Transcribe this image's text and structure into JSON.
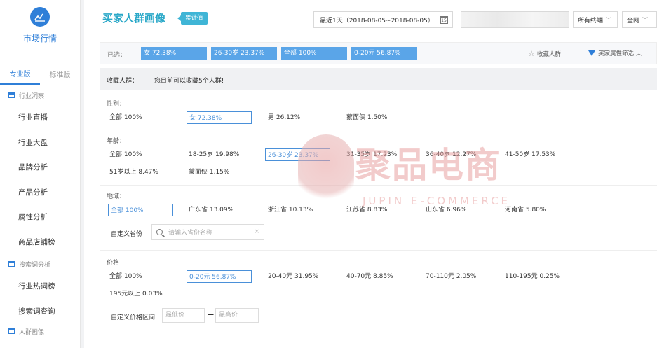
{
  "sidebar": {
    "title": "市场行情",
    "editions": [
      "专业版",
      "标准版"
    ],
    "groups": [
      {
        "label": "行业洞察",
        "items": [
          "行业直播",
          "行业大盘",
          "品牌分析",
          "产品分析",
          "属性分析",
          "商品店铺榜"
        ]
      },
      {
        "label": "搜索词分析",
        "items": [
          "行业热词榜",
          "搜索词查询"
        ]
      },
      {
        "label": "人群画像"
      }
    ]
  },
  "header": {
    "title": "买家人群画像",
    "badge": "累计值",
    "date_range": "最近1天（2018-08-05~2018-08-05）",
    "cal_day": "15",
    "terminal_select": "所有终端",
    "network_select": "全网"
  },
  "selection": {
    "label": "已选：",
    "tags": [
      "女 72.38%",
      "26-30岁 23.37%",
      "全部 100%",
      "0-20元 56.87%"
    ],
    "fav_label": "收藏人群",
    "filter_label": "买家属性筛选"
  },
  "favorites": {
    "label": "收藏人群：",
    "hint": "您目前可以收藏5个人群!"
  },
  "gender": {
    "title": "性别：",
    "options": [
      "全部   100%",
      "女   72.38%",
      "男   26.12%",
      "蒙面侠   1.50%"
    ]
  },
  "age": {
    "title": "年龄：",
    "options": [
      "全部   100%",
      "18-25岁   19.98%",
      "26-30岁   23.37%",
      "31-35岁   17.23%",
      "36-40岁   12.27%",
      "41-50岁   17.53%",
      "51岁以上   8.47%",
      "蒙面侠   1.15%"
    ]
  },
  "region": {
    "title": "地域：",
    "options": [
      "全部   100%",
      "广东省   13.09%",
      "浙江省   10.13%",
      "江苏省   8.83%",
      "山东省   6.96%",
      "河南省   5.80%"
    ],
    "custom_label": "自定义省份",
    "search_placeholder": "请输入省份名称",
    "clear": "×"
  },
  "price": {
    "title": "价格",
    "options": [
      "全部   100%",
      "0-20元   56.87%",
      "20-40元   31.95%",
      "40-70元   8.85%",
      "70-110元   2.05%",
      "110-195元   0.25%",
      "195元以上   0.03%"
    ],
    "custom_label": "自定义价格区间",
    "min_placeholder": "最低价",
    "max_placeholder": "最高价",
    "separator": "—"
  },
  "watermark": {
    "text": "聚品电商",
    "sub": "JUPIN E-COMMERCE"
  },
  "colors": {
    "accent": "#2f7fd8",
    "tag": "#5aa5e8",
    "title": "#2aa8c8"
  }
}
